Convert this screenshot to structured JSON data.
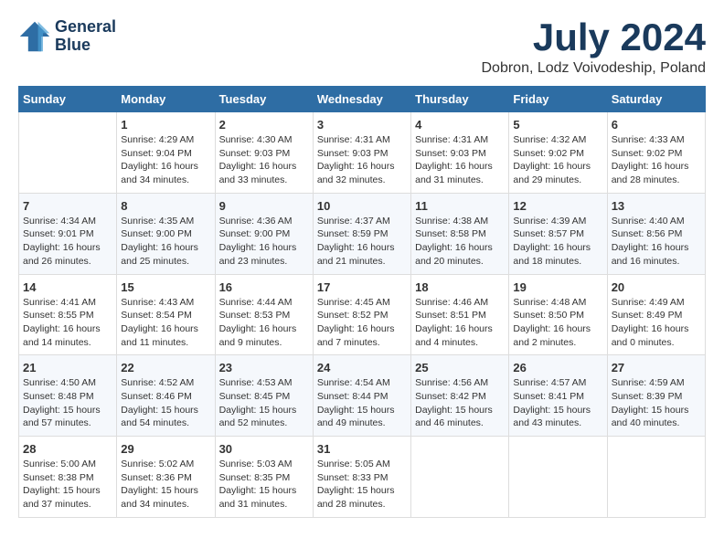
{
  "header": {
    "logo_line1": "General",
    "logo_line2": "Blue",
    "month": "July 2024",
    "location": "Dobron, Lodz Voivodeship, Poland"
  },
  "weekdays": [
    "Sunday",
    "Monday",
    "Tuesday",
    "Wednesday",
    "Thursday",
    "Friday",
    "Saturday"
  ],
  "weeks": [
    [
      {
        "day": "",
        "sunrise": "",
        "sunset": "",
        "daylight": ""
      },
      {
        "day": "1",
        "sunrise": "Sunrise: 4:29 AM",
        "sunset": "Sunset: 9:04 PM",
        "daylight": "Daylight: 16 hours and 34 minutes."
      },
      {
        "day": "2",
        "sunrise": "Sunrise: 4:30 AM",
        "sunset": "Sunset: 9:03 PM",
        "daylight": "Daylight: 16 hours and 33 minutes."
      },
      {
        "day": "3",
        "sunrise": "Sunrise: 4:31 AM",
        "sunset": "Sunset: 9:03 PM",
        "daylight": "Daylight: 16 hours and 32 minutes."
      },
      {
        "day": "4",
        "sunrise": "Sunrise: 4:31 AM",
        "sunset": "Sunset: 9:03 PM",
        "daylight": "Daylight: 16 hours and 31 minutes."
      },
      {
        "day": "5",
        "sunrise": "Sunrise: 4:32 AM",
        "sunset": "Sunset: 9:02 PM",
        "daylight": "Daylight: 16 hours and 29 minutes."
      },
      {
        "day": "6",
        "sunrise": "Sunrise: 4:33 AM",
        "sunset": "Sunset: 9:02 PM",
        "daylight": "Daylight: 16 hours and 28 minutes."
      }
    ],
    [
      {
        "day": "7",
        "sunrise": "Sunrise: 4:34 AM",
        "sunset": "Sunset: 9:01 PM",
        "daylight": "Daylight: 16 hours and 26 minutes."
      },
      {
        "day": "8",
        "sunrise": "Sunrise: 4:35 AM",
        "sunset": "Sunset: 9:00 PM",
        "daylight": "Daylight: 16 hours and 25 minutes."
      },
      {
        "day": "9",
        "sunrise": "Sunrise: 4:36 AM",
        "sunset": "Sunset: 9:00 PM",
        "daylight": "Daylight: 16 hours and 23 minutes."
      },
      {
        "day": "10",
        "sunrise": "Sunrise: 4:37 AM",
        "sunset": "Sunset: 8:59 PM",
        "daylight": "Daylight: 16 hours and 21 minutes."
      },
      {
        "day": "11",
        "sunrise": "Sunrise: 4:38 AM",
        "sunset": "Sunset: 8:58 PM",
        "daylight": "Daylight: 16 hours and 20 minutes."
      },
      {
        "day": "12",
        "sunrise": "Sunrise: 4:39 AM",
        "sunset": "Sunset: 8:57 PM",
        "daylight": "Daylight: 16 hours and 18 minutes."
      },
      {
        "day": "13",
        "sunrise": "Sunrise: 4:40 AM",
        "sunset": "Sunset: 8:56 PM",
        "daylight": "Daylight: 16 hours and 16 minutes."
      }
    ],
    [
      {
        "day": "14",
        "sunrise": "Sunrise: 4:41 AM",
        "sunset": "Sunset: 8:55 PM",
        "daylight": "Daylight: 16 hours and 14 minutes."
      },
      {
        "day": "15",
        "sunrise": "Sunrise: 4:43 AM",
        "sunset": "Sunset: 8:54 PM",
        "daylight": "Daylight: 16 hours and 11 minutes."
      },
      {
        "day": "16",
        "sunrise": "Sunrise: 4:44 AM",
        "sunset": "Sunset: 8:53 PM",
        "daylight": "Daylight: 16 hours and 9 minutes."
      },
      {
        "day": "17",
        "sunrise": "Sunrise: 4:45 AM",
        "sunset": "Sunset: 8:52 PM",
        "daylight": "Daylight: 16 hours and 7 minutes."
      },
      {
        "day": "18",
        "sunrise": "Sunrise: 4:46 AM",
        "sunset": "Sunset: 8:51 PM",
        "daylight": "Daylight: 16 hours and 4 minutes."
      },
      {
        "day": "19",
        "sunrise": "Sunrise: 4:48 AM",
        "sunset": "Sunset: 8:50 PM",
        "daylight": "Daylight: 16 hours and 2 minutes."
      },
      {
        "day": "20",
        "sunrise": "Sunrise: 4:49 AM",
        "sunset": "Sunset: 8:49 PM",
        "daylight": "Daylight: 16 hours and 0 minutes."
      }
    ],
    [
      {
        "day": "21",
        "sunrise": "Sunrise: 4:50 AM",
        "sunset": "Sunset: 8:48 PM",
        "daylight": "Daylight: 15 hours and 57 minutes."
      },
      {
        "day": "22",
        "sunrise": "Sunrise: 4:52 AM",
        "sunset": "Sunset: 8:46 PM",
        "daylight": "Daylight: 15 hours and 54 minutes."
      },
      {
        "day": "23",
        "sunrise": "Sunrise: 4:53 AM",
        "sunset": "Sunset: 8:45 PM",
        "daylight": "Daylight: 15 hours and 52 minutes."
      },
      {
        "day": "24",
        "sunrise": "Sunrise: 4:54 AM",
        "sunset": "Sunset: 8:44 PM",
        "daylight": "Daylight: 15 hours and 49 minutes."
      },
      {
        "day": "25",
        "sunrise": "Sunrise: 4:56 AM",
        "sunset": "Sunset: 8:42 PM",
        "daylight": "Daylight: 15 hours and 46 minutes."
      },
      {
        "day": "26",
        "sunrise": "Sunrise: 4:57 AM",
        "sunset": "Sunset: 8:41 PM",
        "daylight": "Daylight: 15 hours and 43 minutes."
      },
      {
        "day": "27",
        "sunrise": "Sunrise: 4:59 AM",
        "sunset": "Sunset: 8:39 PM",
        "daylight": "Daylight: 15 hours and 40 minutes."
      }
    ],
    [
      {
        "day": "28",
        "sunrise": "Sunrise: 5:00 AM",
        "sunset": "Sunset: 8:38 PM",
        "daylight": "Daylight: 15 hours and 37 minutes."
      },
      {
        "day": "29",
        "sunrise": "Sunrise: 5:02 AM",
        "sunset": "Sunset: 8:36 PM",
        "daylight": "Daylight: 15 hours and 34 minutes."
      },
      {
        "day": "30",
        "sunrise": "Sunrise: 5:03 AM",
        "sunset": "Sunset: 8:35 PM",
        "daylight": "Daylight: 15 hours and 31 minutes."
      },
      {
        "day": "31",
        "sunrise": "Sunrise: 5:05 AM",
        "sunset": "Sunset: 8:33 PM",
        "daylight": "Daylight: 15 hours and 28 minutes."
      },
      {
        "day": "",
        "sunrise": "",
        "sunset": "",
        "daylight": ""
      },
      {
        "day": "",
        "sunrise": "",
        "sunset": "",
        "daylight": ""
      },
      {
        "day": "",
        "sunrise": "",
        "sunset": "",
        "daylight": ""
      }
    ]
  ]
}
